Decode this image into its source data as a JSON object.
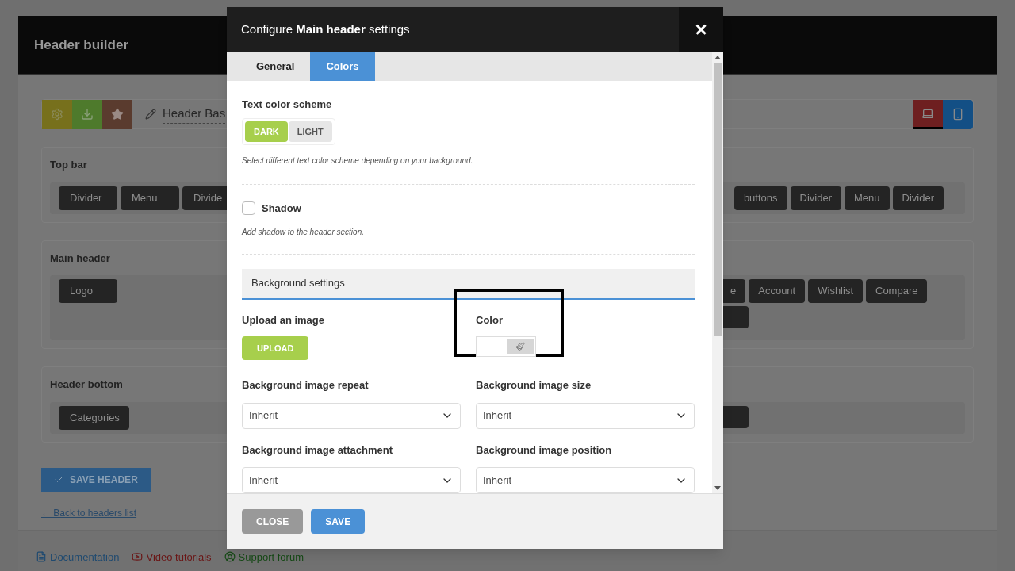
{
  "page": {
    "title": "Header builder",
    "header_name": "Header Bas",
    "devices": [
      {
        "kind": "desktop",
        "selected": true
      },
      {
        "kind": "mobile",
        "selected": false
      }
    ],
    "sections": [
      {
        "title": "Top bar",
        "left_items": [
          {
            "kind": "element",
            "label": "Divider"
          },
          {
            "kind": "element",
            "label": "Menu"
          },
          {
            "kind": "element",
            "label": "Divide"
          }
        ],
        "right_items": [
          {
            "kind": "element",
            "label": "buttons"
          },
          {
            "kind": "element",
            "label": "Divider"
          },
          {
            "kind": "element",
            "label": "Menu"
          },
          {
            "kind": "element",
            "label": "Divider"
          }
        ]
      },
      {
        "title": "Main header",
        "left_items": [
          {
            "kind": "element",
            "label": "Logo"
          }
        ],
        "right_items": [
          {
            "kind": "element",
            "label": "e"
          },
          {
            "kind": "element",
            "label": "Account"
          },
          {
            "kind": "element",
            "label": "Wishlist"
          },
          {
            "kind": "element",
            "label": "Compare"
          },
          {
            "kind": "blank"
          }
        ]
      },
      {
        "title": "Header bottom",
        "left_items": [
          {
            "kind": "element",
            "label": "Categories"
          }
        ],
        "right_items": [
          {
            "kind": "blank"
          }
        ]
      }
    ],
    "save_button": "SAVE HEADER",
    "back_link": "← Back to headers list",
    "footer_links": [
      {
        "kind": "doc",
        "label": "Documentation"
      },
      {
        "kind": "video",
        "label": "Video tutorials"
      },
      {
        "kind": "forum",
        "label": "Support forum"
      }
    ]
  },
  "modal": {
    "title": "Configure **Main header** settings",
    "close": "×",
    "tabs": [
      {
        "label": "General",
        "selected": false
      },
      {
        "label": "Colors",
        "selected": true
      }
    ],
    "scheme": {
      "label": "Text color scheme",
      "options": [
        {
          "label": "DARK",
          "selected": true
        },
        {
          "label": "LIGHT",
          "selected": false
        }
      ],
      "hint": "Select different text color scheme depending on your background."
    },
    "shadow": {
      "label": "Shadow",
      "checked": false,
      "hint": "Add shadow to the header section."
    },
    "background": {
      "heading": "Background settings",
      "upload_label": "Upload an image",
      "upload_button": "UPLOAD",
      "color_label": "Color",
      "highlighted": true,
      "selects": [
        {
          "label": "Background image repeat",
          "value": "Inherit"
        },
        {
          "label": "Background image size",
          "value": "Inherit"
        },
        {
          "label": "Background image attachment",
          "value": "Inherit"
        },
        {
          "label": "Background image position",
          "value": "Inherit"
        }
      ]
    },
    "buttons": [
      {
        "kind": "close",
        "label": "CLOSE"
      },
      {
        "kind": "save",
        "label": "SAVE"
      }
    ]
  }
}
